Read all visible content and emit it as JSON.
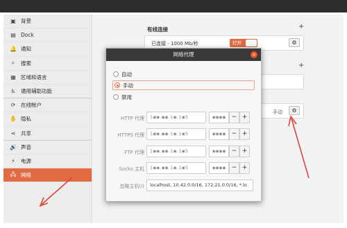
{
  "sidebar": {
    "items": [
      {
        "icon": "background-icon",
        "glyph": "▣",
        "label": "背景"
      },
      {
        "icon": "dock-icon",
        "glyph": "▤",
        "label": "Dock"
      },
      {
        "icon": "bell-icon",
        "glyph": "🔔",
        "label": "通知"
      },
      {
        "icon": "search-icon",
        "glyph": "⌕",
        "label": "搜索"
      },
      {
        "icon": "region-icon",
        "glyph": "▦",
        "label": "区域和语言"
      },
      {
        "icon": "accessibility-icon",
        "glyph": "♿",
        "label": "通用辅助功能"
      },
      {
        "icon": "online-accounts-icon",
        "glyph": "⟳",
        "label": "在线帐户"
      },
      {
        "icon": "privacy-icon",
        "glyph": "✋",
        "label": "隐私"
      },
      {
        "icon": "share-icon",
        "glyph": "⋖",
        "label": "共享"
      },
      {
        "icon": "sound-icon",
        "glyph": "🔊",
        "label": "声音"
      },
      {
        "icon": "power-icon",
        "glyph": "⚡",
        "label": "电源"
      },
      {
        "icon": "network-icon",
        "glyph": "🖧",
        "label": "网络"
      }
    ]
  },
  "main": {
    "wired_title": "有线连接",
    "wired_status": "已连接 - 1000 Mb/秒",
    "toggle_label": "打开",
    "proxy_mode_value": "手动"
  },
  "dialog": {
    "title": "网络代理",
    "close_glyph": "×",
    "modes": [
      "自动",
      "手动",
      "禁用"
    ],
    "selected_mode": "手动",
    "rows": [
      {
        "label": "HTTP 代理",
        "host": "1▪▪.▪▪.1▪.1▪5",
        "port": "▪▪▪▪"
      },
      {
        "label": "HTTPS 代理",
        "host": "1▪▪.▪▪.1▪.1▪5",
        "port": "▪▪▪▪"
      },
      {
        "label": "FTP 代理",
        "host": "1▪▪.▪▪.1▪.1▪5",
        "port": "▪▪▪▪"
      },
      {
        "label": "Socks 主机",
        "host": "1▪▪.▪▪.1▪.1▪5",
        "port": "▪▪▪▪"
      }
    ],
    "ignore_label": "忽略主机(I)",
    "ignore_value": "localhost, 10.42.0.0/16, 172.21.0.0/16, *.lo",
    "minus": "−",
    "plus": "+"
  },
  "colors": {
    "accent": "#e06a41",
    "arrow": "#e0413a"
  }
}
